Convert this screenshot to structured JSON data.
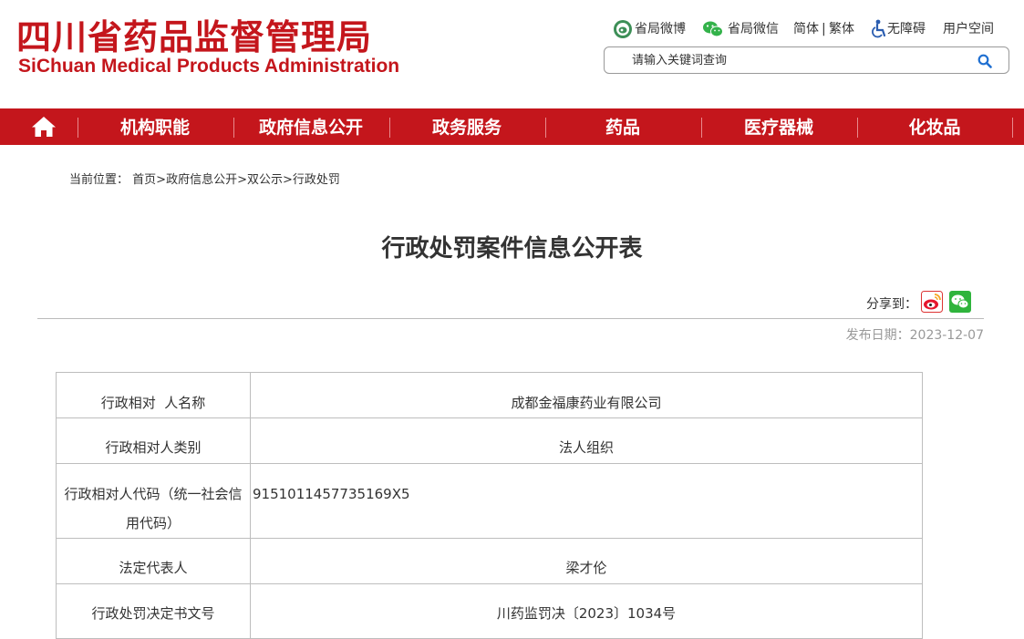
{
  "header": {
    "logo_cn": "四川省药品监督管理局",
    "logo_en": "SiChuan Medical Products Administration",
    "links": {
      "weibo": "省局微博",
      "wechat": "省局微信",
      "simplified": "简体",
      "separator": "|",
      "traditional": "繁体",
      "accessibility": "无障碍",
      "user_space": "用户空间"
    },
    "search": {
      "placeholder": "请输入关键词查询"
    }
  },
  "nav": {
    "items": [
      {
        "label": "机构职能"
      },
      {
        "label": "政府信息公开"
      },
      {
        "label": "政务服务"
      },
      {
        "label": "药品"
      },
      {
        "label": "医疗器械"
      },
      {
        "label": "化妆品"
      }
    ]
  },
  "breadcrumb": {
    "prefix": "当前位置：",
    "items": [
      "首页",
      "政府信息公开",
      "双公示",
      "行政处罚"
    ],
    "separator": ">"
  },
  "article": {
    "title": "行政处罚案件信息公开表",
    "share_label": "分享到：",
    "publish_date": "发布日期：2023-12-07"
  },
  "table": {
    "rows": [
      {
        "label": "行政相对  人名称",
        "value": "成都金福康药业有限公司"
      },
      {
        "label": "行政相对人类别",
        "value": "法人组织"
      },
      {
        "label": "行政相对人代码（统一社会信用代码）",
        "value": "9151011457735169X5"
      },
      {
        "label": "法定代表人",
        "value": "梁才伦"
      },
      {
        "label": "行政处罚决定书文号",
        "value": "川药监罚决〔2023〕1034号"
      }
    ]
  },
  "colors": {
    "brand_red": "#c4161c",
    "date_gray": "#999999",
    "border": "#bdbdbd"
  }
}
